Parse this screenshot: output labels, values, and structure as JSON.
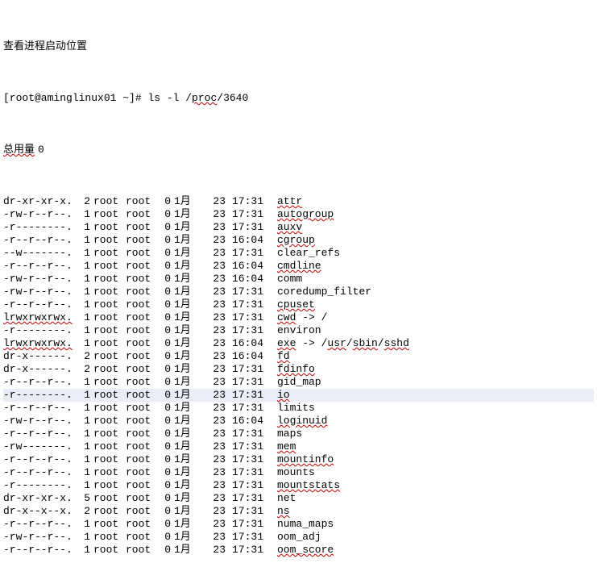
{
  "heading": "查看进程启动位置",
  "prompt": "[root@aminglinux01 ~]# ",
  "command": "ls -l /proc/3640",
  "command_plain_prefix": "ls -l /",
  "command_wavy_mid": "proc",
  "command_plain_suffix": "/3640",
  "total_label": "总用量",
  "total_value": "0",
  "cols": {
    "owner": "root",
    "group": "root",
    "size": "0",
    "month": "1月"
  },
  "rows": [
    {
      "perms": "dr-xr-xr-x.",
      "links": "2",
      "day": "23",
      "time": "17:31",
      "name": "attr",
      "wavy": true,
      "hl": false
    },
    {
      "perms": "-rw-r--r--.",
      "links": "1",
      "day": "23",
      "time": "17:31",
      "name": "autogroup",
      "wavy": true,
      "hl": false
    },
    {
      "perms": "-r--------.",
      "links": "1",
      "day": "23",
      "time": "17:31",
      "name": "auxv",
      "wavy": true,
      "hl": false
    },
    {
      "perms": "-r--r--r--.",
      "links": "1",
      "day": "23",
      "time": "16:04",
      "name": "cgroup",
      "wavy": true,
      "hl": false
    },
    {
      "perms": "--w-------.",
      "links": "1",
      "day": "23",
      "time": "17:31",
      "name": "clear_refs",
      "wavy": false,
      "hl": false
    },
    {
      "perms": "-r--r--r--.",
      "links": "1",
      "day": "23",
      "time": "16:04",
      "name": "cmdline",
      "wavy": true,
      "hl": false
    },
    {
      "perms": "-rw-r--r--.",
      "links": "1",
      "day": "23",
      "time": "16:04",
      "name": "comm",
      "wavy": false,
      "hl": false
    },
    {
      "perms": "-rw-r--r--.",
      "links": "1",
      "day": "23",
      "time": "17:31",
      "name": "coredump_filter",
      "wavy": false,
      "hl": false
    },
    {
      "perms": "-r--r--r--.",
      "links": "1",
      "day": "23",
      "time": "17:31",
      "name": "cpuset",
      "wavy": true,
      "hl": false
    },
    {
      "perms": "lrwxrwxrwx.",
      "links": "1",
      "day": "23",
      "time": "17:31",
      "name": "cwd",
      "wavy": true,
      "hl": false,
      "arrow": " -> /",
      "perms_wavy": true
    },
    {
      "perms": "-r--------.",
      "links": "1",
      "day": "23",
      "time": "17:31",
      "name": "environ",
      "wavy": false,
      "hl": false
    },
    {
      "perms": "lrwxrwxrwx.",
      "links": "1",
      "day": "23",
      "time": "16:04",
      "name": "exe",
      "wavy": true,
      "hl": false,
      "arrow": " -> /usr/sbin/sshd",
      "arrow_parts": [
        {
          "t": " -> /",
          "w": false
        },
        {
          "t": "usr",
          "w": true
        },
        {
          "t": "/",
          "w": false
        },
        {
          "t": "sbin",
          "w": true
        },
        {
          "t": "/",
          "w": false
        },
        {
          "t": "sshd",
          "w": true
        }
      ],
      "perms_wavy": true
    },
    {
      "perms": "dr-x------.",
      "links": "2",
      "day": "23",
      "time": "16:04",
      "name": "fd",
      "wavy": true,
      "hl": false
    },
    {
      "perms": "dr-x------.",
      "links": "2",
      "day": "23",
      "time": "17:31",
      "name": "fdinfo",
      "wavy": true,
      "hl": false
    },
    {
      "perms": "-r--r--r--.",
      "links": "1",
      "day": "23",
      "time": "17:31",
      "name": "gid_map",
      "wavy": false,
      "hl": false
    },
    {
      "perms": "-r--------.",
      "links": "1",
      "day": "23",
      "time": "17:31",
      "name": "io",
      "wavy": true,
      "hl": true
    },
    {
      "perms": "-r--r--r--.",
      "links": "1",
      "day": "23",
      "time": "17:31",
      "name": "limits",
      "wavy": false,
      "hl": false
    },
    {
      "perms": "-rw-r--r--.",
      "links": "1",
      "day": "23",
      "time": "16:04",
      "name": "loginuid",
      "wavy": true,
      "hl": false
    },
    {
      "perms": "-r--r--r--.",
      "links": "1",
      "day": "23",
      "time": "17:31",
      "name": "maps",
      "wavy": false,
      "hl": false
    },
    {
      "perms": "-rw-------.",
      "links": "1",
      "day": "23",
      "time": "17:31",
      "name": "mem",
      "wavy": true,
      "hl": false
    },
    {
      "perms": "-r--r--r--.",
      "links": "1",
      "day": "23",
      "time": "17:31",
      "name": "mountinfo",
      "wavy": true,
      "hl": false
    },
    {
      "perms": "-r--r--r--.",
      "links": "1",
      "day": "23",
      "time": "17:31",
      "name": "mounts",
      "wavy": false,
      "hl": false
    },
    {
      "perms": "-r--------.",
      "links": "1",
      "day": "23",
      "time": "17:31",
      "name": "mountstats",
      "wavy": true,
      "hl": false
    },
    {
      "perms": "dr-xr-xr-x.",
      "links": "5",
      "day": "23",
      "time": "17:31",
      "name": "net",
      "wavy": false,
      "hl": false
    },
    {
      "perms": "dr-x--x--x.",
      "links": "2",
      "day": "23",
      "time": "17:31",
      "name": "ns",
      "wavy": true,
      "hl": false
    },
    {
      "perms": "-r--r--r--.",
      "links": "1",
      "day": "23",
      "time": "17:31",
      "name": "numa_maps",
      "wavy": false,
      "hl": false
    },
    {
      "perms": "-rw-r--r--.",
      "links": "1",
      "day": "23",
      "time": "17:31",
      "name": "oom_adj",
      "wavy": false,
      "hl": false
    },
    {
      "perms": "-r--r--r--.",
      "links": "1",
      "day": "23",
      "time": "17:31",
      "name": "oom_score",
      "wavy": true,
      "hl": false
    }
  ]
}
